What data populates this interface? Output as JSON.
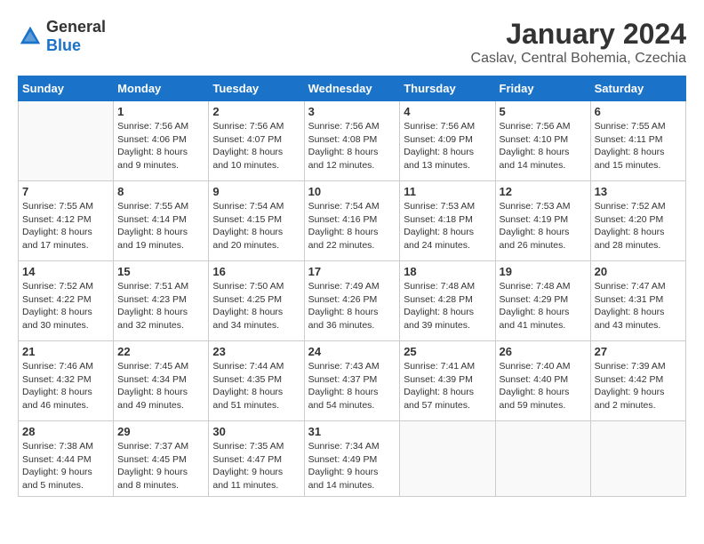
{
  "header": {
    "logo_general": "General",
    "logo_blue": "Blue",
    "month_title": "January 2024",
    "subtitle": "Caslav, Central Bohemia, Czechia"
  },
  "days_of_week": [
    "Sunday",
    "Monday",
    "Tuesday",
    "Wednesday",
    "Thursday",
    "Friday",
    "Saturday"
  ],
  "weeks": [
    [
      {
        "day": "",
        "sunrise": "",
        "sunset": "",
        "daylight": ""
      },
      {
        "day": "1",
        "sunrise": "Sunrise: 7:56 AM",
        "sunset": "Sunset: 4:06 PM",
        "daylight": "Daylight: 8 hours and 9 minutes."
      },
      {
        "day": "2",
        "sunrise": "Sunrise: 7:56 AM",
        "sunset": "Sunset: 4:07 PM",
        "daylight": "Daylight: 8 hours and 10 minutes."
      },
      {
        "day": "3",
        "sunrise": "Sunrise: 7:56 AM",
        "sunset": "Sunset: 4:08 PM",
        "daylight": "Daylight: 8 hours and 12 minutes."
      },
      {
        "day": "4",
        "sunrise": "Sunrise: 7:56 AM",
        "sunset": "Sunset: 4:09 PM",
        "daylight": "Daylight: 8 hours and 13 minutes."
      },
      {
        "day": "5",
        "sunrise": "Sunrise: 7:56 AM",
        "sunset": "Sunset: 4:10 PM",
        "daylight": "Daylight: 8 hours and 14 minutes."
      },
      {
        "day": "6",
        "sunrise": "Sunrise: 7:55 AM",
        "sunset": "Sunset: 4:11 PM",
        "daylight": "Daylight: 8 hours and 15 minutes."
      }
    ],
    [
      {
        "day": "7",
        "sunrise": "Sunrise: 7:55 AM",
        "sunset": "Sunset: 4:12 PM",
        "daylight": "Daylight: 8 hours and 17 minutes."
      },
      {
        "day": "8",
        "sunrise": "Sunrise: 7:55 AM",
        "sunset": "Sunset: 4:14 PM",
        "daylight": "Daylight: 8 hours and 19 minutes."
      },
      {
        "day": "9",
        "sunrise": "Sunrise: 7:54 AM",
        "sunset": "Sunset: 4:15 PM",
        "daylight": "Daylight: 8 hours and 20 minutes."
      },
      {
        "day": "10",
        "sunrise": "Sunrise: 7:54 AM",
        "sunset": "Sunset: 4:16 PM",
        "daylight": "Daylight: 8 hours and 22 minutes."
      },
      {
        "day": "11",
        "sunrise": "Sunrise: 7:53 AM",
        "sunset": "Sunset: 4:18 PM",
        "daylight": "Daylight: 8 hours and 24 minutes."
      },
      {
        "day": "12",
        "sunrise": "Sunrise: 7:53 AM",
        "sunset": "Sunset: 4:19 PM",
        "daylight": "Daylight: 8 hours and 26 minutes."
      },
      {
        "day": "13",
        "sunrise": "Sunrise: 7:52 AM",
        "sunset": "Sunset: 4:20 PM",
        "daylight": "Daylight: 8 hours and 28 minutes."
      }
    ],
    [
      {
        "day": "14",
        "sunrise": "Sunrise: 7:52 AM",
        "sunset": "Sunset: 4:22 PM",
        "daylight": "Daylight: 8 hours and 30 minutes."
      },
      {
        "day": "15",
        "sunrise": "Sunrise: 7:51 AM",
        "sunset": "Sunset: 4:23 PM",
        "daylight": "Daylight: 8 hours and 32 minutes."
      },
      {
        "day": "16",
        "sunrise": "Sunrise: 7:50 AM",
        "sunset": "Sunset: 4:25 PM",
        "daylight": "Daylight: 8 hours and 34 minutes."
      },
      {
        "day": "17",
        "sunrise": "Sunrise: 7:49 AM",
        "sunset": "Sunset: 4:26 PM",
        "daylight": "Daylight: 8 hours and 36 minutes."
      },
      {
        "day": "18",
        "sunrise": "Sunrise: 7:48 AM",
        "sunset": "Sunset: 4:28 PM",
        "daylight": "Daylight: 8 hours and 39 minutes."
      },
      {
        "day": "19",
        "sunrise": "Sunrise: 7:48 AM",
        "sunset": "Sunset: 4:29 PM",
        "daylight": "Daylight: 8 hours and 41 minutes."
      },
      {
        "day": "20",
        "sunrise": "Sunrise: 7:47 AM",
        "sunset": "Sunset: 4:31 PM",
        "daylight": "Daylight: 8 hours and 43 minutes."
      }
    ],
    [
      {
        "day": "21",
        "sunrise": "Sunrise: 7:46 AM",
        "sunset": "Sunset: 4:32 PM",
        "daylight": "Daylight: 8 hours and 46 minutes."
      },
      {
        "day": "22",
        "sunrise": "Sunrise: 7:45 AM",
        "sunset": "Sunset: 4:34 PM",
        "daylight": "Daylight: 8 hours and 49 minutes."
      },
      {
        "day": "23",
        "sunrise": "Sunrise: 7:44 AM",
        "sunset": "Sunset: 4:35 PM",
        "daylight": "Daylight: 8 hours and 51 minutes."
      },
      {
        "day": "24",
        "sunrise": "Sunrise: 7:43 AM",
        "sunset": "Sunset: 4:37 PM",
        "daylight": "Daylight: 8 hours and 54 minutes."
      },
      {
        "day": "25",
        "sunrise": "Sunrise: 7:41 AM",
        "sunset": "Sunset: 4:39 PM",
        "daylight": "Daylight: 8 hours and 57 minutes."
      },
      {
        "day": "26",
        "sunrise": "Sunrise: 7:40 AM",
        "sunset": "Sunset: 4:40 PM",
        "daylight": "Daylight: 8 hours and 59 minutes."
      },
      {
        "day": "27",
        "sunrise": "Sunrise: 7:39 AM",
        "sunset": "Sunset: 4:42 PM",
        "daylight": "Daylight: 9 hours and 2 minutes."
      }
    ],
    [
      {
        "day": "28",
        "sunrise": "Sunrise: 7:38 AM",
        "sunset": "Sunset: 4:44 PM",
        "daylight": "Daylight: 9 hours and 5 minutes."
      },
      {
        "day": "29",
        "sunrise": "Sunrise: 7:37 AM",
        "sunset": "Sunset: 4:45 PM",
        "daylight": "Daylight: 9 hours and 8 minutes."
      },
      {
        "day": "30",
        "sunrise": "Sunrise: 7:35 AM",
        "sunset": "Sunset: 4:47 PM",
        "daylight": "Daylight: 9 hours and 11 minutes."
      },
      {
        "day": "31",
        "sunrise": "Sunrise: 7:34 AM",
        "sunset": "Sunset: 4:49 PM",
        "daylight": "Daylight: 9 hours and 14 minutes."
      },
      {
        "day": "",
        "sunrise": "",
        "sunset": "",
        "daylight": ""
      },
      {
        "day": "",
        "sunrise": "",
        "sunset": "",
        "daylight": ""
      },
      {
        "day": "",
        "sunrise": "",
        "sunset": "",
        "daylight": ""
      }
    ]
  ]
}
